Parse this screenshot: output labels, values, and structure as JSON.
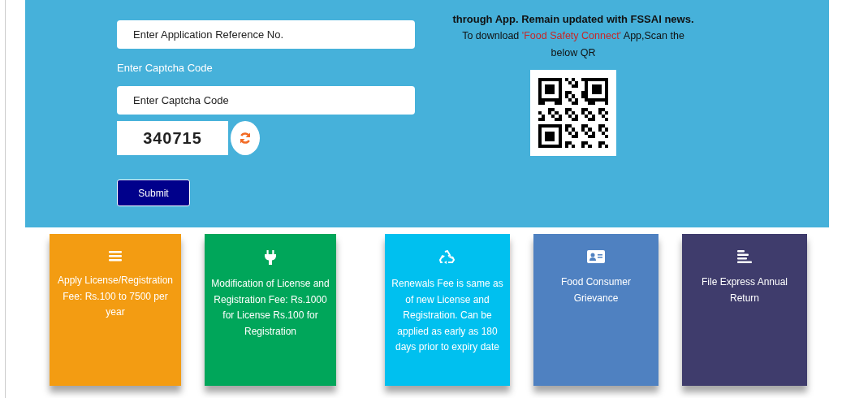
{
  "form": {
    "reference_field": {
      "placeholder": "Enter Application Reference No."
    },
    "captcha_label": "Enter Captcha Code",
    "captcha_field": {
      "placeholder": "Enter Captcha Code"
    },
    "captcha_code": "340715",
    "submit": "Submit"
  },
  "app_promo": {
    "line": "through App. Remain updated with FSSAI news.",
    "download_text": "To download **'Food Safety Connect'** App,Scan the below QR"
  },
  "cards": [
    {
      "kind": "list",
      "color": "#f39c12",
      "text": "Apply License/Registration Fee: Rs.100 to 7500 per year"
    },
    {
      "kind": "plug",
      "color": "#00a65a",
      "text": "Modification of License and Registration Fee: Rs.1000 for License Rs.100 for Registration"
    },
    {
      "kind": "recycle",
      "color": "#00c0ef",
      "text": "Renewals Fee is same as of new License and Registration. Can be applied as early as 180 days prior to expiry date"
    },
    {
      "kind": "idcard",
      "color": "#4f81c1",
      "text": "Food Consumer Grievance"
    },
    {
      "kind": "lines",
      "color": "#3f3c6c",
      "text": "File Express Annual Return"
    }
  ]
}
